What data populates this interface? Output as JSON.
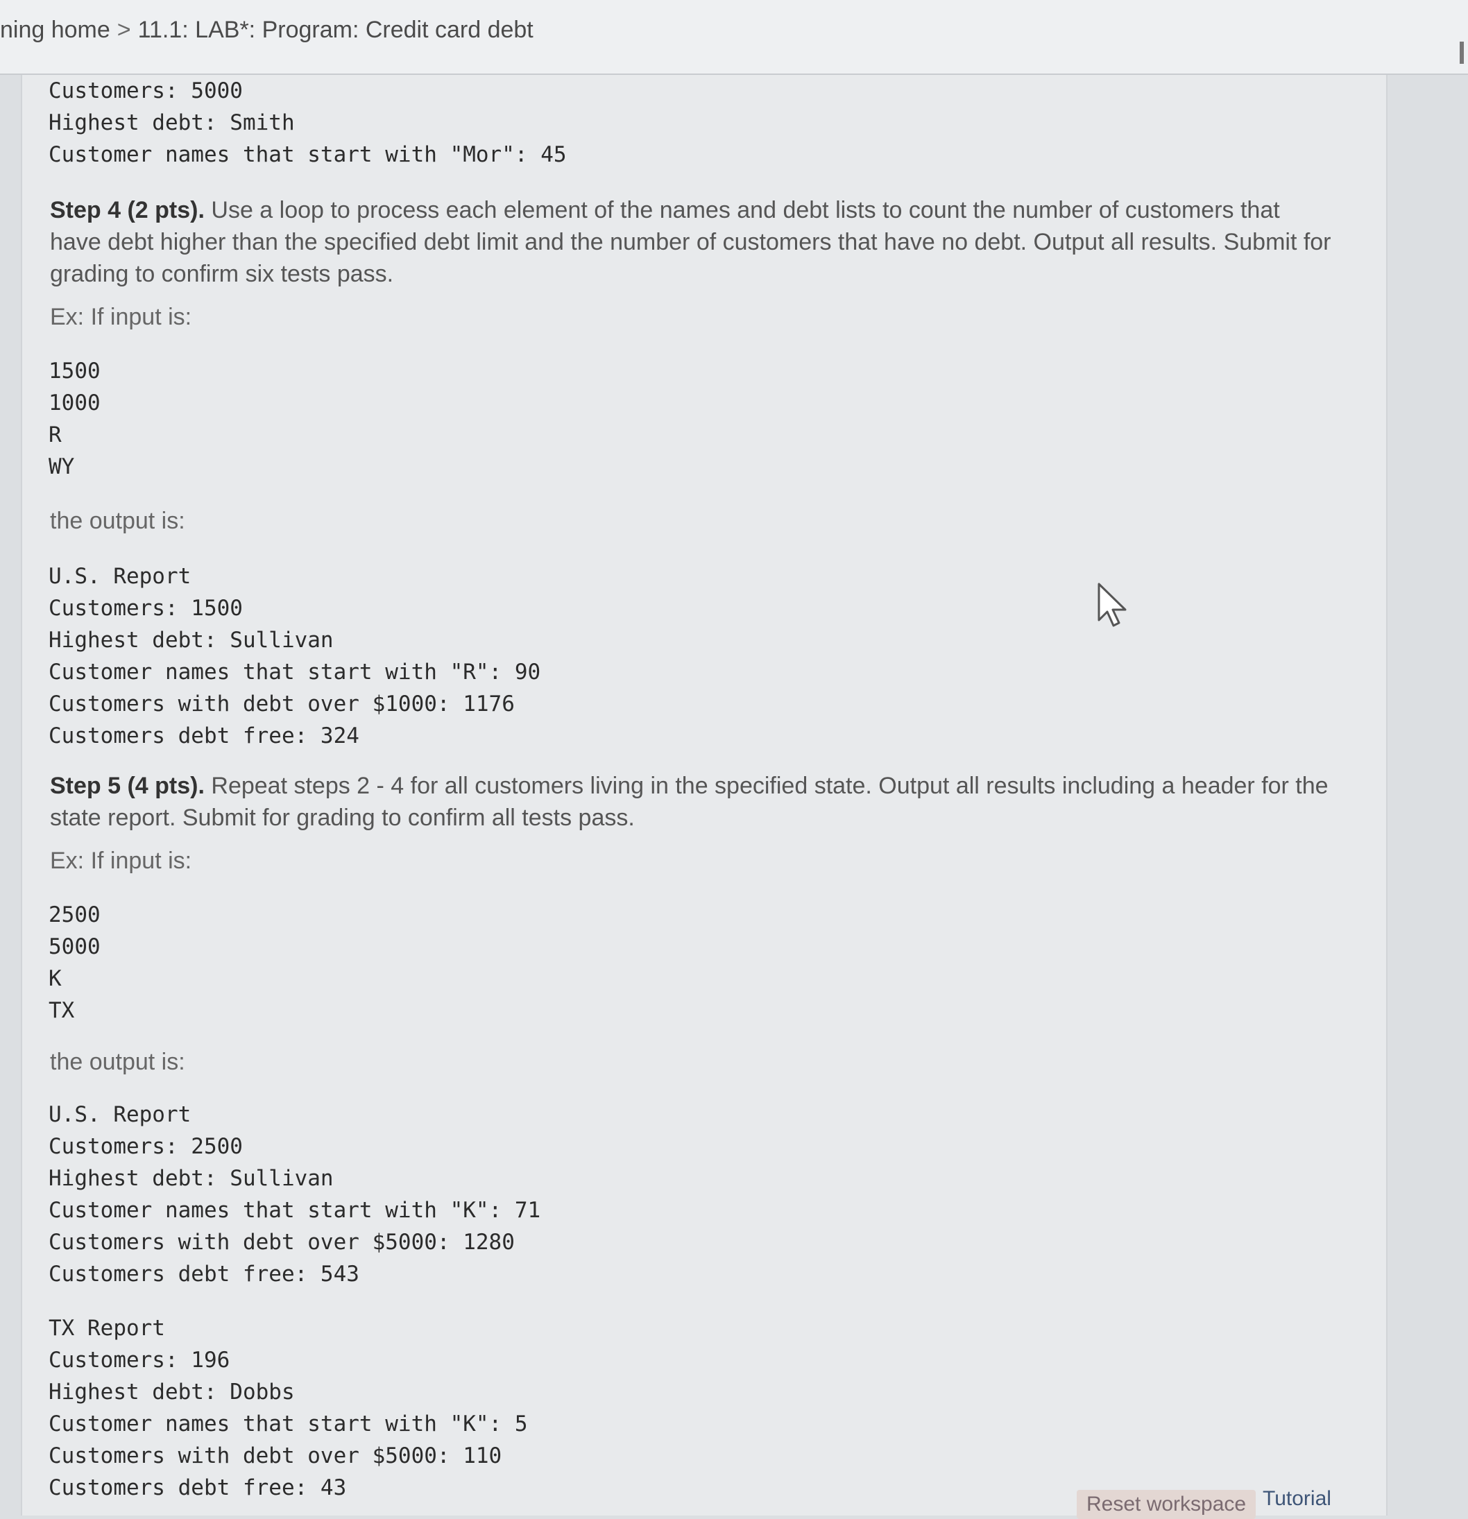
{
  "header": {
    "breadcrumb_root": "ning home",
    "breadcrumb_sep": ">",
    "breadcrumb_current": "11.1: LAB*: Program: Credit card debt"
  },
  "top_output": [
    "Customers: 5000",
    "Highest debt: Smith",
    "Customer names that start with \"Mor\": 45"
  ],
  "step4": {
    "title": "Step 4 (2 pts).",
    "body": "Use a loop to process each element of the names and debt lists to count the number of customers that have debt higher than the specified debt limit and the number of customers that have no debt. Output all results. Submit for grading to confirm six tests pass.",
    "input_label": "Ex: If input is:",
    "input_lines": [
      "1500",
      "1000",
      "R",
      "WY"
    ],
    "output_label": "the output is:",
    "output_lines": [
      "U.S. Report",
      "Customers: 1500",
      "Highest debt: Sullivan",
      "Customer names that start with \"R\": 90",
      "Customers with debt over $1000: 1176",
      "Customers debt free: 324"
    ]
  },
  "step5": {
    "title": "Step 5 (4 pts).",
    "body": "Repeat steps 2 - 4 for all customers living in the specified state. Output all results including a header for the state report. Submit for grading to confirm all tests pass.",
    "input_label": "Ex: If input is:",
    "input_lines": [
      "2500",
      "5000",
      "K",
      "TX"
    ],
    "output_label": "the output is:",
    "us_report_lines": [
      "U.S. Report",
      "Customers: 2500",
      "Highest debt: Sullivan",
      "Customer names that start with \"K\": 71",
      "Customers with debt over $5000: 1280",
      "Customers debt free: 543"
    ],
    "state_report_lines": [
      "TX Report",
      "Customers: 196",
      "Highest debt: Dobbs",
      "Customer names that start with \"K\": 5",
      "Customers with debt over $5000: 110",
      "Customers debt free: 43"
    ]
  },
  "footer": {
    "reset_label": "Reset workspace",
    "tutorial_label": "Tutorial"
  }
}
